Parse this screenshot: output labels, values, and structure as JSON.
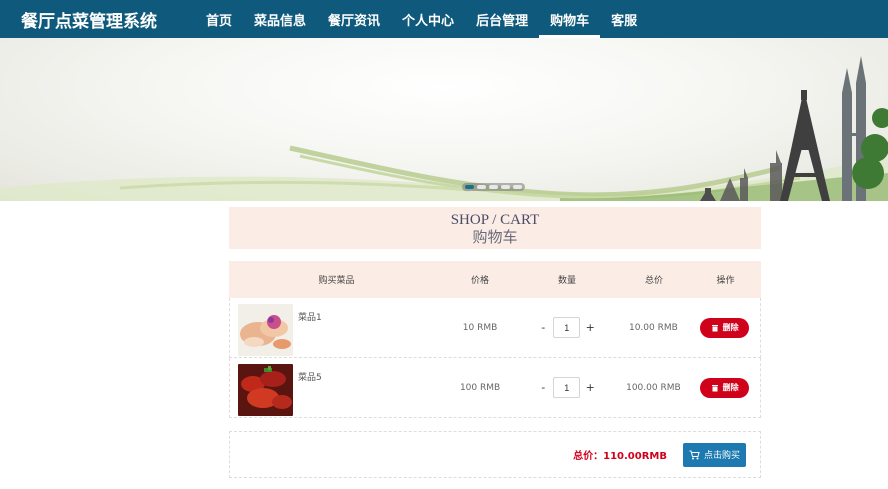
{
  "header": {
    "brand": "餐厅点菜管理系统",
    "nav": [
      {
        "label": "首页"
      },
      {
        "label": "菜品信息"
      },
      {
        "label": "餐厅资讯"
      },
      {
        "label": "个人中心"
      },
      {
        "label": "后台管理"
      },
      {
        "label": "购物车",
        "active": true
      },
      {
        "label": "客服"
      }
    ]
  },
  "banner": {
    "slides_total": 5,
    "active_slide": 1
  },
  "title": {
    "en": "SHOP / CART",
    "cn": "购物车"
  },
  "cart": {
    "columns": [
      "购买菜品",
      "价格",
      "数量",
      "总价",
      "操作"
    ],
    "rows": [
      {
        "name": "菜品1",
        "price": "10 RMB",
        "qty": "1",
        "total": "10.00 RMB",
        "delete_label": "删除"
      },
      {
        "name": "菜品5",
        "price": "100 RMB",
        "qty": "1",
        "total": "100.00 RMB",
        "delete_label": "删除"
      }
    ],
    "minus_label": "-",
    "plus_label": "+"
  },
  "summary": {
    "total_text": "总价：110.00RMB",
    "buy_label": "点击购买"
  },
  "colors": {
    "nav_bg": "#0f5a7c",
    "header_bg": "#fbede6",
    "danger": "#d0011b",
    "primary": "#1c7ab0"
  }
}
